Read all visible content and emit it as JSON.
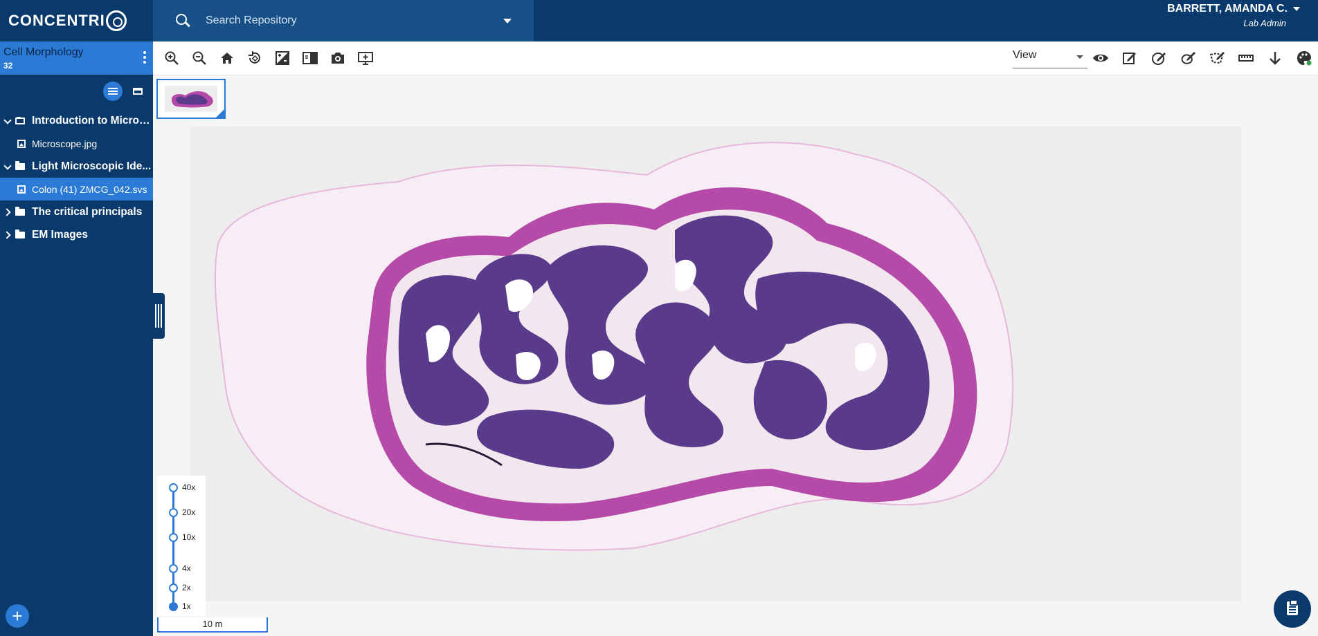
{
  "app": {
    "logo_text": "CONCENTRI"
  },
  "search": {
    "placeholder": "Search Repository"
  },
  "user": {
    "name": "BARRETT, AMANDA C.",
    "role": "Lab Admin"
  },
  "project": {
    "title": "Cell Morphology",
    "count": "32"
  },
  "tree": [
    {
      "label": "Introduction to Micros...",
      "type": "folder",
      "expanded": true
    },
    {
      "label": "Microscope.jpg",
      "type": "image"
    },
    {
      "label": "Light Microscopic Ide...",
      "type": "folder",
      "expanded": true
    },
    {
      "label": "Colon (41) ZMCG_042.svs",
      "type": "image",
      "selected": true
    },
    {
      "label": "The critical principals",
      "type": "folder",
      "expanded": false
    },
    {
      "label": "EM Images",
      "type": "folder",
      "expanded": false
    }
  ],
  "toolbar": {
    "left_icons": [
      "zoom-in-icon",
      "zoom-out-icon",
      "home-icon",
      "rotate-icon",
      "adjust-image-icon",
      "compare-icon",
      "camera-icon",
      "present-icon"
    ],
    "mode_label": "View",
    "right_icons": [
      "eye-icon",
      "edit-annotation-icon",
      "annotate-circle-icon",
      "annotate-freehand-icon",
      "annotate-polygon-icon",
      "ruler-icon",
      "download-icon",
      "palette-icon"
    ]
  },
  "zoom_levels": [
    "40x",
    "20x",
    "10x",
    "4x",
    "2x",
    "1x"
  ],
  "zoom_active": "1x",
  "scale_bar": "10 m",
  "colors": {
    "navy": "#0a3a6b",
    "accent": "#2a7ad6",
    "tissue_dark": "#5a3a8a",
    "tissue_pink": "#b54aa8"
  }
}
